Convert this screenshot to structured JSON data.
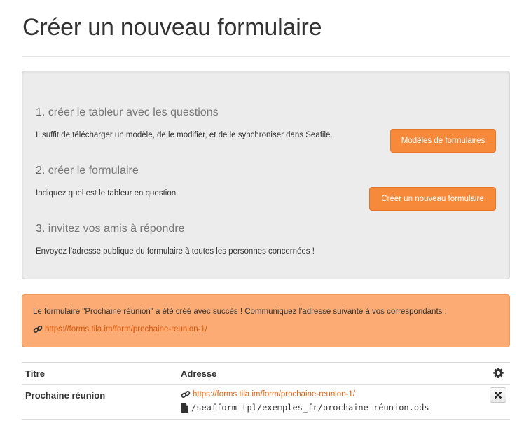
{
  "page": {
    "title": "Créer un nouveau formulaire"
  },
  "steps": [
    {
      "number": "1.",
      "heading": "créer le tableur avec les questions",
      "text": "Il suffit de télécharger un modèle, de le modifier, et de le synchroniser dans Seafile.",
      "button": "Modèles de formulaires"
    },
    {
      "number": "2.",
      "heading": "créer le formulaire",
      "text": "Indiquez quel est le tableur en question.",
      "button": "Créer un nouveau formulaire"
    },
    {
      "number": "3.",
      "heading": "invitez vos amis à répondre",
      "text": "Envoyez l'adresse publique du formulaire à toutes les personnes concernées !"
    }
  ],
  "alert": {
    "message": "Le formulaire \"Prochaine réunion\" a été créé avec succès ! Communiquez l'adresse suivante à vos correspondants :",
    "link": "https://forms.tila.im/form/prochaine-reunion-1/"
  },
  "table": {
    "headers": {
      "title": "Titre",
      "address": "Adresse"
    },
    "rows": [
      {
        "title": "Prochaine réunion",
        "link": "https://forms.tila.im/form/prochaine-reunion-1/",
        "file": "/seafform-tpl/exemples_fr/prochaine-réunion.ods"
      }
    ]
  },
  "icons": {
    "link": "link-icon",
    "file": "file-icon",
    "settings": "gear-icon",
    "delete": "close-icon"
  },
  "colors": {
    "accent": "#f7893b",
    "alert_bg": "#fbab73",
    "link": "#e8610c"
  }
}
